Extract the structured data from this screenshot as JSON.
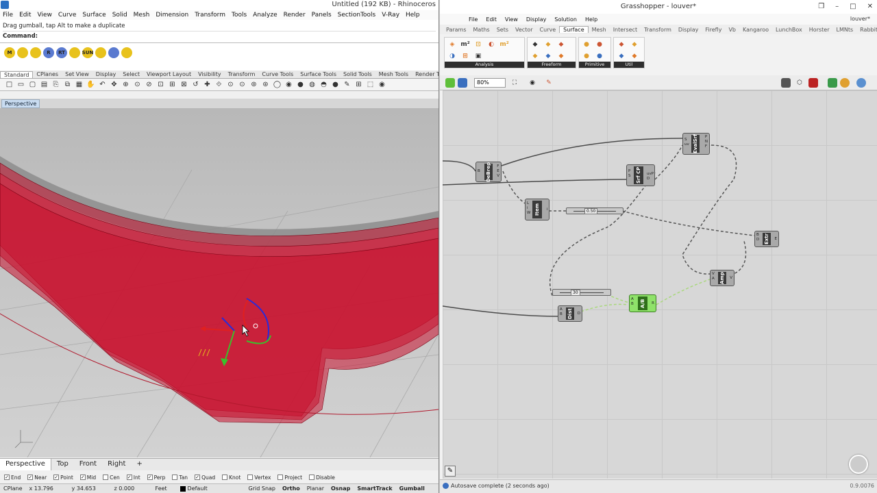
{
  "rhino": {
    "title": "Untitled (192 KB) - Rhinoceros",
    "menu": [
      "File",
      "Edit",
      "View",
      "Curve",
      "Surface",
      "Solid",
      "Mesh",
      "Dimension",
      "Transform",
      "Tools",
      "Analyze",
      "Render",
      "Panels",
      "SectionTools",
      "V-Ray",
      "Help"
    ],
    "prompt": "Drag gumball, tap Alt to make a duplicate",
    "command_label": "Command:",
    "quick_buttons": [
      "M",
      "",
      "",
      "R",
      "RT",
      "",
      "SUN",
      "",
      "",
      ""
    ],
    "tabs": [
      "Standard",
      "CPlanes",
      "Set View",
      "Display",
      "Select",
      "Viewport Layout",
      "Visibility",
      "Transform",
      "Curve Tools",
      "Surface Tools",
      "Solid Tools",
      "Mesh Tools",
      "Render Tools",
      "Drafting"
    ],
    "active_tab": "Standard",
    "viewport_label": "Perspective",
    "viewport_tabs": [
      "Perspective",
      "Top",
      "Front",
      "Right"
    ],
    "add_tab_icon": "+",
    "osnaps": [
      {
        "label": "End",
        "checked": true
      },
      {
        "label": "Near",
        "checked": true
      },
      {
        "label": "Point",
        "checked": true
      },
      {
        "label": "Mid",
        "checked": true
      },
      {
        "label": "Cen",
        "checked": false
      },
      {
        "label": "Int",
        "checked": true
      },
      {
        "label": "Perp",
        "checked": true
      },
      {
        "label": "Tan",
        "checked": false
      },
      {
        "label": "Quad",
        "checked": true
      },
      {
        "label": "Knot",
        "checked": false
      },
      {
        "label": "Vertex",
        "checked": false
      },
      {
        "label": "Project",
        "checked": false
      },
      {
        "label": "Disable",
        "checked": false
      }
    ],
    "status": {
      "cplane": "CPlane",
      "x": "x 13.796",
      "y": "y 34.653",
      "z": "z 0.000",
      "units": "Feet",
      "layer": "Default",
      "grid_snap": "Grid Snap",
      "ortho": "Ortho",
      "planar": "Planar",
      "osnap": "Osnap",
      "smarttrack": "SmartTrack",
      "gumball": "Gumball"
    },
    "colors": {
      "louver_red": "#c8102e",
      "axis_red": "#e02020",
      "axis_green": "#3cbf2c",
      "axis_blue": "#2a2ad8"
    }
  },
  "gh": {
    "title": "Grasshopper - louver*",
    "menu": [
      "File",
      "Edit",
      "View",
      "Display",
      "Solution",
      "Help"
    ],
    "user": "louver*",
    "tabs": [
      "Params",
      "Maths",
      "Sets",
      "Vector",
      "Curve",
      "Surface",
      "Mesh",
      "Intersect",
      "Transform",
      "Display",
      "Firefly",
      "Vb",
      "Kangaroo",
      "LunchBox",
      "Horster",
      "LMNts",
      "Rabbit"
    ],
    "active_tab": "Surface",
    "ribbon_panels": [
      {
        "label": "Analysis",
        "icons": [
          "◈",
          "m²",
          "⊡",
          "◐",
          "m²",
          "◑",
          "⊞",
          "▣"
        ]
      },
      {
        "label": "Freeform",
        "icons": [
          "◆",
          "◆",
          "◆",
          "◆",
          "◆",
          "◆"
        ]
      },
      {
        "label": "Primitive",
        "icons": [
          "●",
          "●",
          "●",
          "●"
        ]
      },
      {
        "label": "Util",
        "icons": [
          "◆",
          "◆",
          "◆",
          "◆"
        ]
      }
    ],
    "zoom": "80%",
    "nodes": {
      "deBrep": {
        "label": "DeBrep",
        "pins_left": "B",
        "pins_right": "F\nE\nV"
      },
      "srfcp": {
        "label": "Srf CP",
        "pins_left": "P\nS",
        "pins_right": "uvP\nD"
      },
      "evalsrf": {
        "label": "EvalSrf",
        "pins_left": "S\nuv",
        "pins_right": "P\nN\nF"
      },
      "item": {
        "label": "Item",
        "pins_left": "L\ni\nW",
        "pins_right": "i"
      },
      "extr": {
        "label": "Extr",
        "pins_left": "B\nD",
        "pins_right": "E"
      },
      "amp": {
        "label": "Amp",
        "pins_left": "V\nA",
        "pins_right": "V"
      },
      "ab": {
        "label": "A/B",
        "pins_left": "A\nB",
        "pins_right": "R"
      },
      "dist": {
        "label": "Dist",
        "pins_left": "A\nB",
        "pins_right": "D"
      }
    },
    "slider1": "0.50",
    "slider2": "30",
    "status_msg": "Autosave complete (2 seconds ago)",
    "version": "0.9.0076"
  }
}
